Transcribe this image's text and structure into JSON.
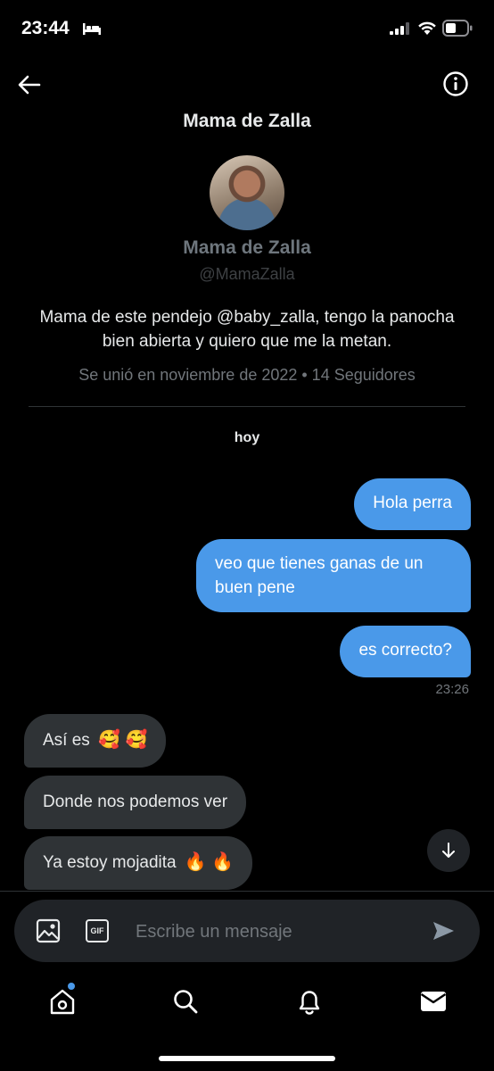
{
  "status_bar": {
    "time": "23:44"
  },
  "header": {
    "title": "Mama de Zalla"
  },
  "profile": {
    "name": "Mama de Zalla",
    "handle": "@MamaZalla",
    "bio": "Mama de este pendejo @baby_zalla, tengo la panocha bien abierta y quiero que me la metan.",
    "joined": "Se unió en noviembre de 2022 • 14 Seguidores"
  },
  "conversation": {
    "day_label": "hoy",
    "sent": [
      {
        "text": "Hola perra"
      },
      {
        "text": "veo que tienes ganas de un buen pene"
      },
      {
        "text": "es correcto?"
      }
    ],
    "sent_time": "23:26",
    "received": [
      {
        "text": "Así es",
        "emoji": "🥰 🥰"
      },
      {
        "text": "Donde nos podemos ver"
      },
      {
        "text": "Ya estoy mojadita",
        "emoji": "🔥 🔥"
      }
    ]
  },
  "composer": {
    "placeholder": "Escribe un mensaje",
    "gif_label": "GIF"
  },
  "colors": {
    "accent": "#4a99e9",
    "bubble_in": "#2f3336",
    "background": "#000000"
  }
}
